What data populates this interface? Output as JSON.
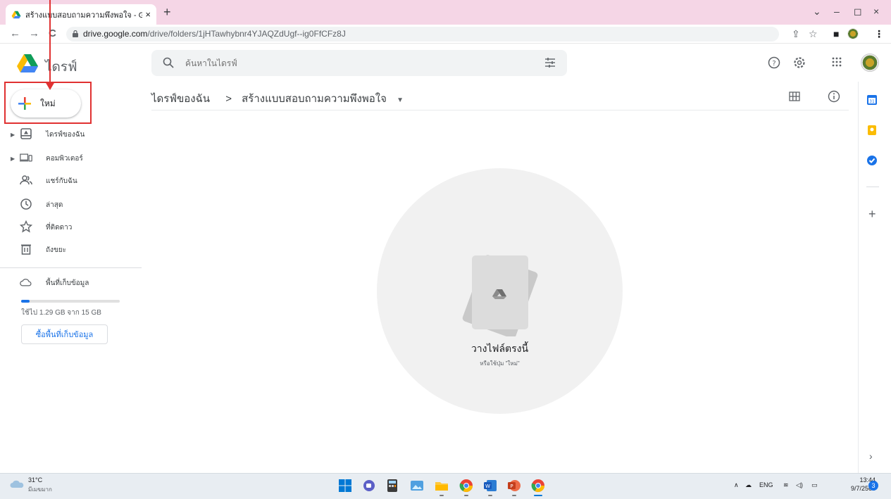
{
  "browser": {
    "tab_title": "สร้างแบบสอบถามความพึงพอใจ - Goo",
    "tab_close": "×",
    "new_tab": "+",
    "url_host": "drive.google.com",
    "url_path": "/drive/folders/1jHTawhybnr4YJAQZdUgf--ig0FfCFz8J",
    "back": "←",
    "forward": "→",
    "reload": "C",
    "window_controls": {
      "chevron": "⌄",
      "minimize": "–",
      "maximize": "◻",
      "close": "×"
    }
  },
  "header": {
    "brand": "ไดรฟ์",
    "search_placeholder": "ค้นหาในไดรฟ์"
  },
  "sidebar": {
    "new_label": "ใหม่",
    "items": [
      {
        "label": "ไดรฟ์ของฉัน",
        "icon": "my-drive-icon",
        "caret": true
      },
      {
        "label": "คอมพิวเตอร์",
        "icon": "computer-icon",
        "caret": true
      },
      {
        "label": "แชร์กับฉัน",
        "icon": "shared-icon",
        "caret": false
      },
      {
        "label": "ล่าสุด",
        "icon": "clock-icon",
        "caret": false
      },
      {
        "label": "ที่ติดดาว",
        "icon": "star-icon",
        "caret": false
      },
      {
        "label": "ถังขยะ",
        "icon": "trash-icon",
        "caret": false
      }
    ],
    "storage_label": "พื้นที่เก็บข้อมูล",
    "storage_used_text": "ใช้ไป 1.29 GB จาก 15 GB",
    "storage_fraction": 0.086,
    "buy_storage_label": "ซื้อพื้นที่เก็บข้อมูล"
  },
  "main": {
    "breadcrumb_root": "ไดรฟ์ของฉัน",
    "breadcrumb_sep": ">",
    "breadcrumb_current": "สร้างแบบสอบถามความพึงพอใจ",
    "drop_title": "วางไฟล์ตรงนี้",
    "drop_subtitle": "หรือใช้ปุ่ม \"ใหม่\""
  },
  "taskbar": {
    "temperature": "31°C",
    "weather_desc": "มีเมฆมาก",
    "lang": "ENG",
    "time": "13:44",
    "date": "9/7/2565",
    "notification_count": "3"
  },
  "colors": {
    "annotation_red": "#e03131",
    "accent_blue": "#1a73e8",
    "tab_strip": "#f5d6e6"
  }
}
